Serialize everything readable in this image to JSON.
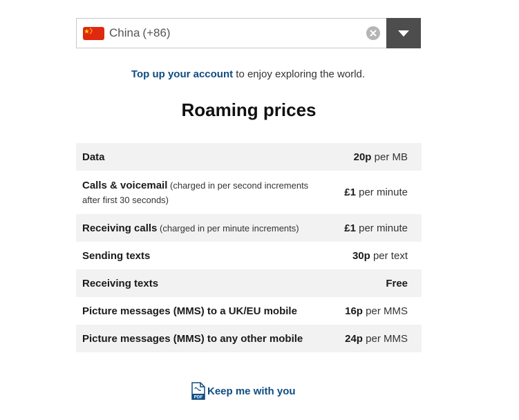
{
  "country_selector": {
    "country": "China",
    "dial_code": "(+86)",
    "flag_icon": "china-flag-icon",
    "clear_icon": "clear-icon",
    "dropdown_icon": "chevron-down-icon"
  },
  "topup": {
    "link_text": "Top up your account",
    "rest_text": " to enjoy exploring the world."
  },
  "title": "Roaming prices",
  "prices": [
    {
      "name": "Data",
      "note": "",
      "amount": "20p",
      "unit": " per MB"
    },
    {
      "name": "Calls & voicemail",
      "note": " (charged in per second increments after first 30 seconds)",
      "amount": "£1",
      "unit": " per minute"
    },
    {
      "name": "Receiving calls",
      "note": " (charged in per minute increments)",
      "amount": "£1",
      "unit": " per minute"
    },
    {
      "name": "Sending texts",
      "note": "",
      "amount": "30p",
      "unit": " per text"
    },
    {
      "name": "Receiving texts",
      "note": "",
      "amount": "Free",
      "unit": ""
    },
    {
      "name": "Picture messages (MMS) to a UK/EU mobile",
      "note": "",
      "amount": "16p",
      "unit": " per MMS"
    },
    {
      "name": "Picture messages (MMS) to any other mobile",
      "note": "",
      "amount": "24p",
      "unit": " per MMS"
    }
  ],
  "pdf_link": {
    "icon": "pdf-icon",
    "icon_text": "PDF",
    "label": "Keep me with you"
  },
  "colors": {
    "link": "#0f4c81",
    "row_alt": "#f2f2f2",
    "dropdown_bg": "#4d4d4d",
    "flag_red": "#de2910",
    "flag_yellow": "#ffde00"
  }
}
